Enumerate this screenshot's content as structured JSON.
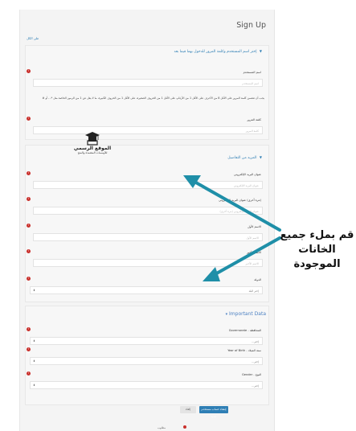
{
  "header": {
    "title": "Sign Up",
    "collapse_all": "طي الكل"
  },
  "section_account": {
    "heading": "إختر اسم المستخدم وكلمة المرور للدخول بهما فيما بعد",
    "username_label": "اسم المستخدم",
    "username_placeholder": "اسم المستخدم",
    "password_hint": "يجب أن تتضمن كلمة المرور على الأقل 8 من الأحرف على الأقل 1 من الأرقام، على الأقل 1 من الحروف الصغيرة، على الأقل 1 من الحروف الكبيرة، ما لا يقل عن 1 من الرموز الخاصة مثل *، - أو #",
    "password_label": "كلمة المرور",
    "password_placeholder": "كلمة المرور"
  },
  "section_more": {
    "heading": "المزيد من التفاصيل",
    "email_label": "عنوان البريد الإلكتروني",
    "email_placeholder": "عنوان البريد الإلكتروني",
    "email_confirm_label": "(مرة أخرى) عنوان البريد الإلكتروني",
    "email_confirm_placeholder": "عنوان البريد الإلكتروني (مرة أخرى)",
    "firstname_label": "الاسم الأول",
    "firstname_placeholder": "الاسم الأول",
    "lastname_label": "الاسم الأخير",
    "lastname_placeholder": "الاسم الأخير",
    "country_label": "الدولة",
    "country_value": "إختر البلد"
  },
  "section_important": {
    "heading": "Important Data",
    "governorate_label": "المحافظة - Governorate",
    "governorate_value": "إختر...",
    "year_label": "سنة الميلاد - Year of Birth",
    "year_value": "إختر...",
    "gender_label": "النوع - Gender",
    "gender_value": "إختر..."
  },
  "actions": {
    "submit_label": "إنشاء حساب مستخدم جديد",
    "cancel_label": "إلغاء"
  },
  "footer": {
    "required_note": "مطلوب"
  },
  "logo": {
    "line1": "الموقع الرسمي",
    "line2": "للأوسمات المعتمدة والمنح"
  },
  "annotation": {
    "line1": "قم بملء جميع",
    "line2": "الخانات الموجودة"
  },
  "colors": {
    "accent": "#2f7fb5",
    "required": "#c9302c",
    "arrow": "#1f8fa8"
  }
}
